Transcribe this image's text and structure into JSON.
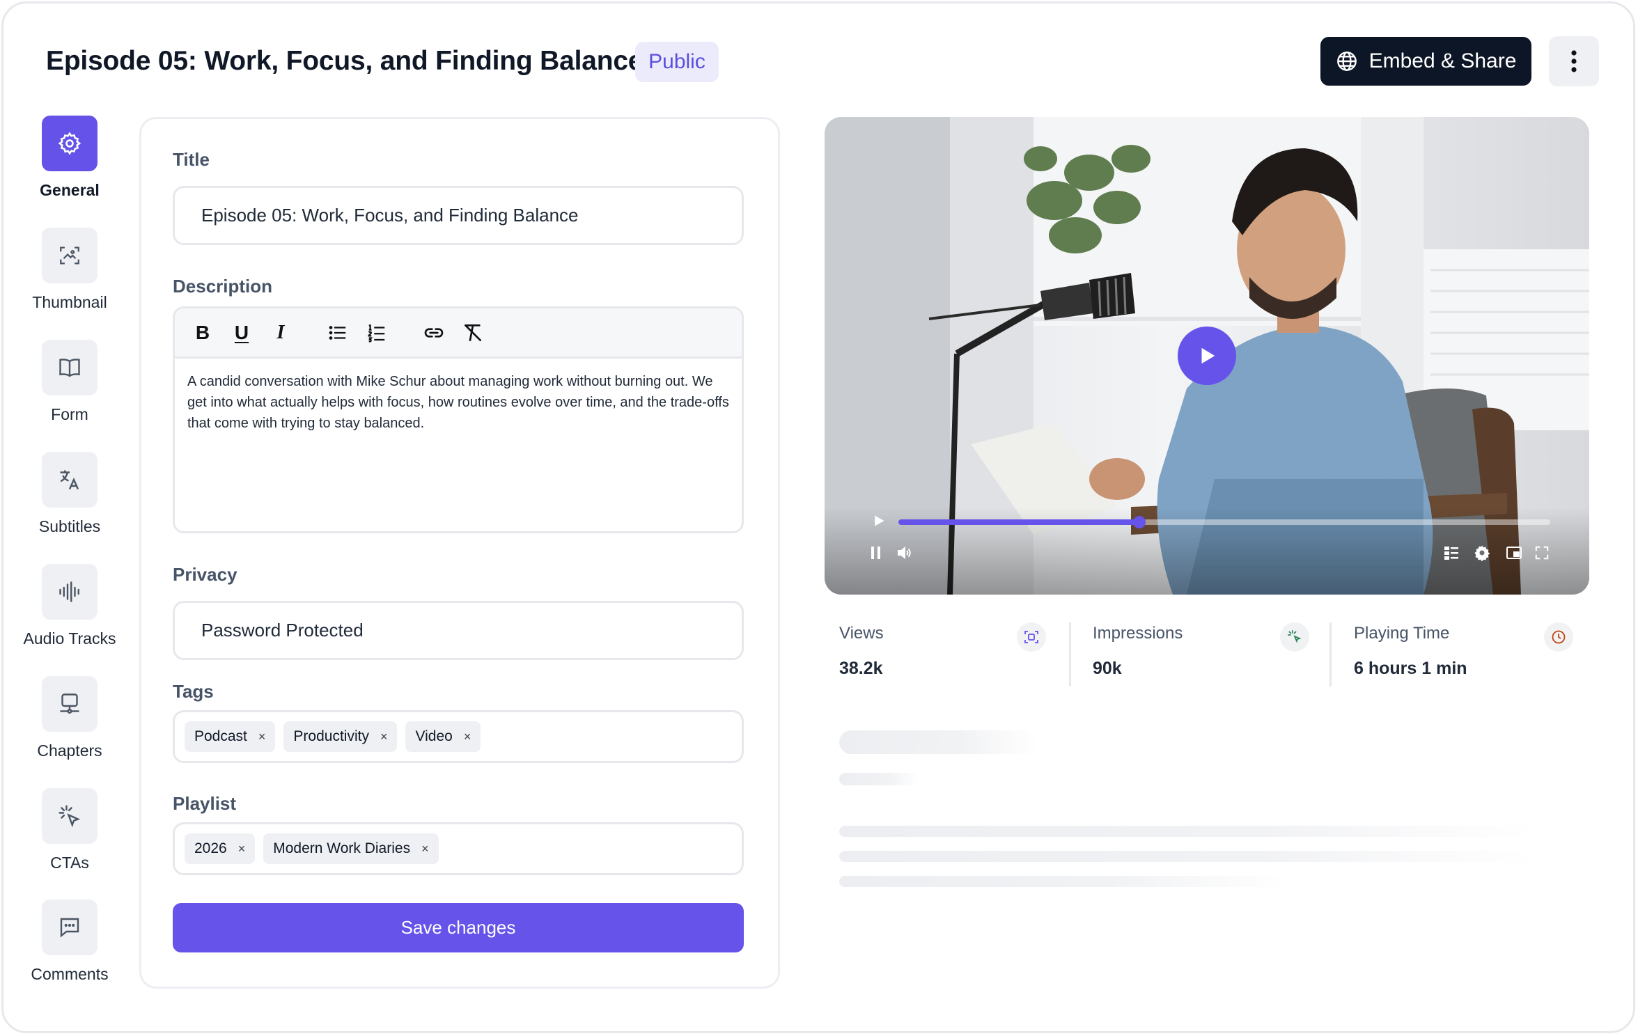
{
  "header": {
    "title": "Episode 05: Work, Focus, and Finding Balance",
    "visibility_badge": "Public",
    "embed_label": "Embed & Share"
  },
  "sidebar": {
    "items": [
      {
        "label": "General",
        "icon": "gear-icon",
        "active": true
      },
      {
        "label": "Thumbnail",
        "icon": "image-scan-icon"
      },
      {
        "label": "Form",
        "icon": "book-icon"
      },
      {
        "label": "Subtitles",
        "icon": "translate-icon"
      },
      {
        "label": "Audio Tracks",
        "icon": "waveform-icon"
      },
      {
        "label": "Chapters",
        "icon": "chapters-icon"
      },
      {
        "label": "CTAs",
        "icon": "cursor-click-icon"
      },
      {
        "label": "Comments",
        "icon": "comment-icon"
      }
    ]
  },
  "form": {
    "title_label": "Title",
    "title_value": "Episode 05: Work, Focus, and Finding Balance",
    "description_label": "Description",
    "description_text": "A candid conversation with Mike Schur about managing work without burning out. We get into what actually helps with focus, how routines evolve over time, and the trade-offs that come with trying to stay balanced.",
    "toolbar": {
      "bold": "B",
      "underline": "U",
      "italic": "I"
    },
    "privacy_label": "Privacy",
    "privacy_value": "Password Protected",
    "tags_label": "Tags",
    "tags": [
      "Podcast",
      "Productivity",
      "Video"
    ],
    "playlist_label": "Playlist",
    "playlists": [
      "2026",
      "Modern Work Diaries"
    ],
    "remove_glyph": "×",
    "save_label": "Save changes"
  },
  "video": {
    "progress": 0.37,
    "accent": "#6553ea"
  },
  "stats": [
    {
      "name": "Views",
      "value": "38.2k",
      "icon": "scan-icon"
    },
    {
      "name": "Impressions",
      "value": "90k",
      "icon": "sparkle-icon"
    },
    {
      "name": "Playing Time",
      "value": "6 hours 1 min",
      "icon": "clock-icon"
    }
  ],
  "colors": {
    "accent": "#6553ea",
    "dark_button": "#0d1626",
    "badge_bg": "#ecebfb"
  }
}
